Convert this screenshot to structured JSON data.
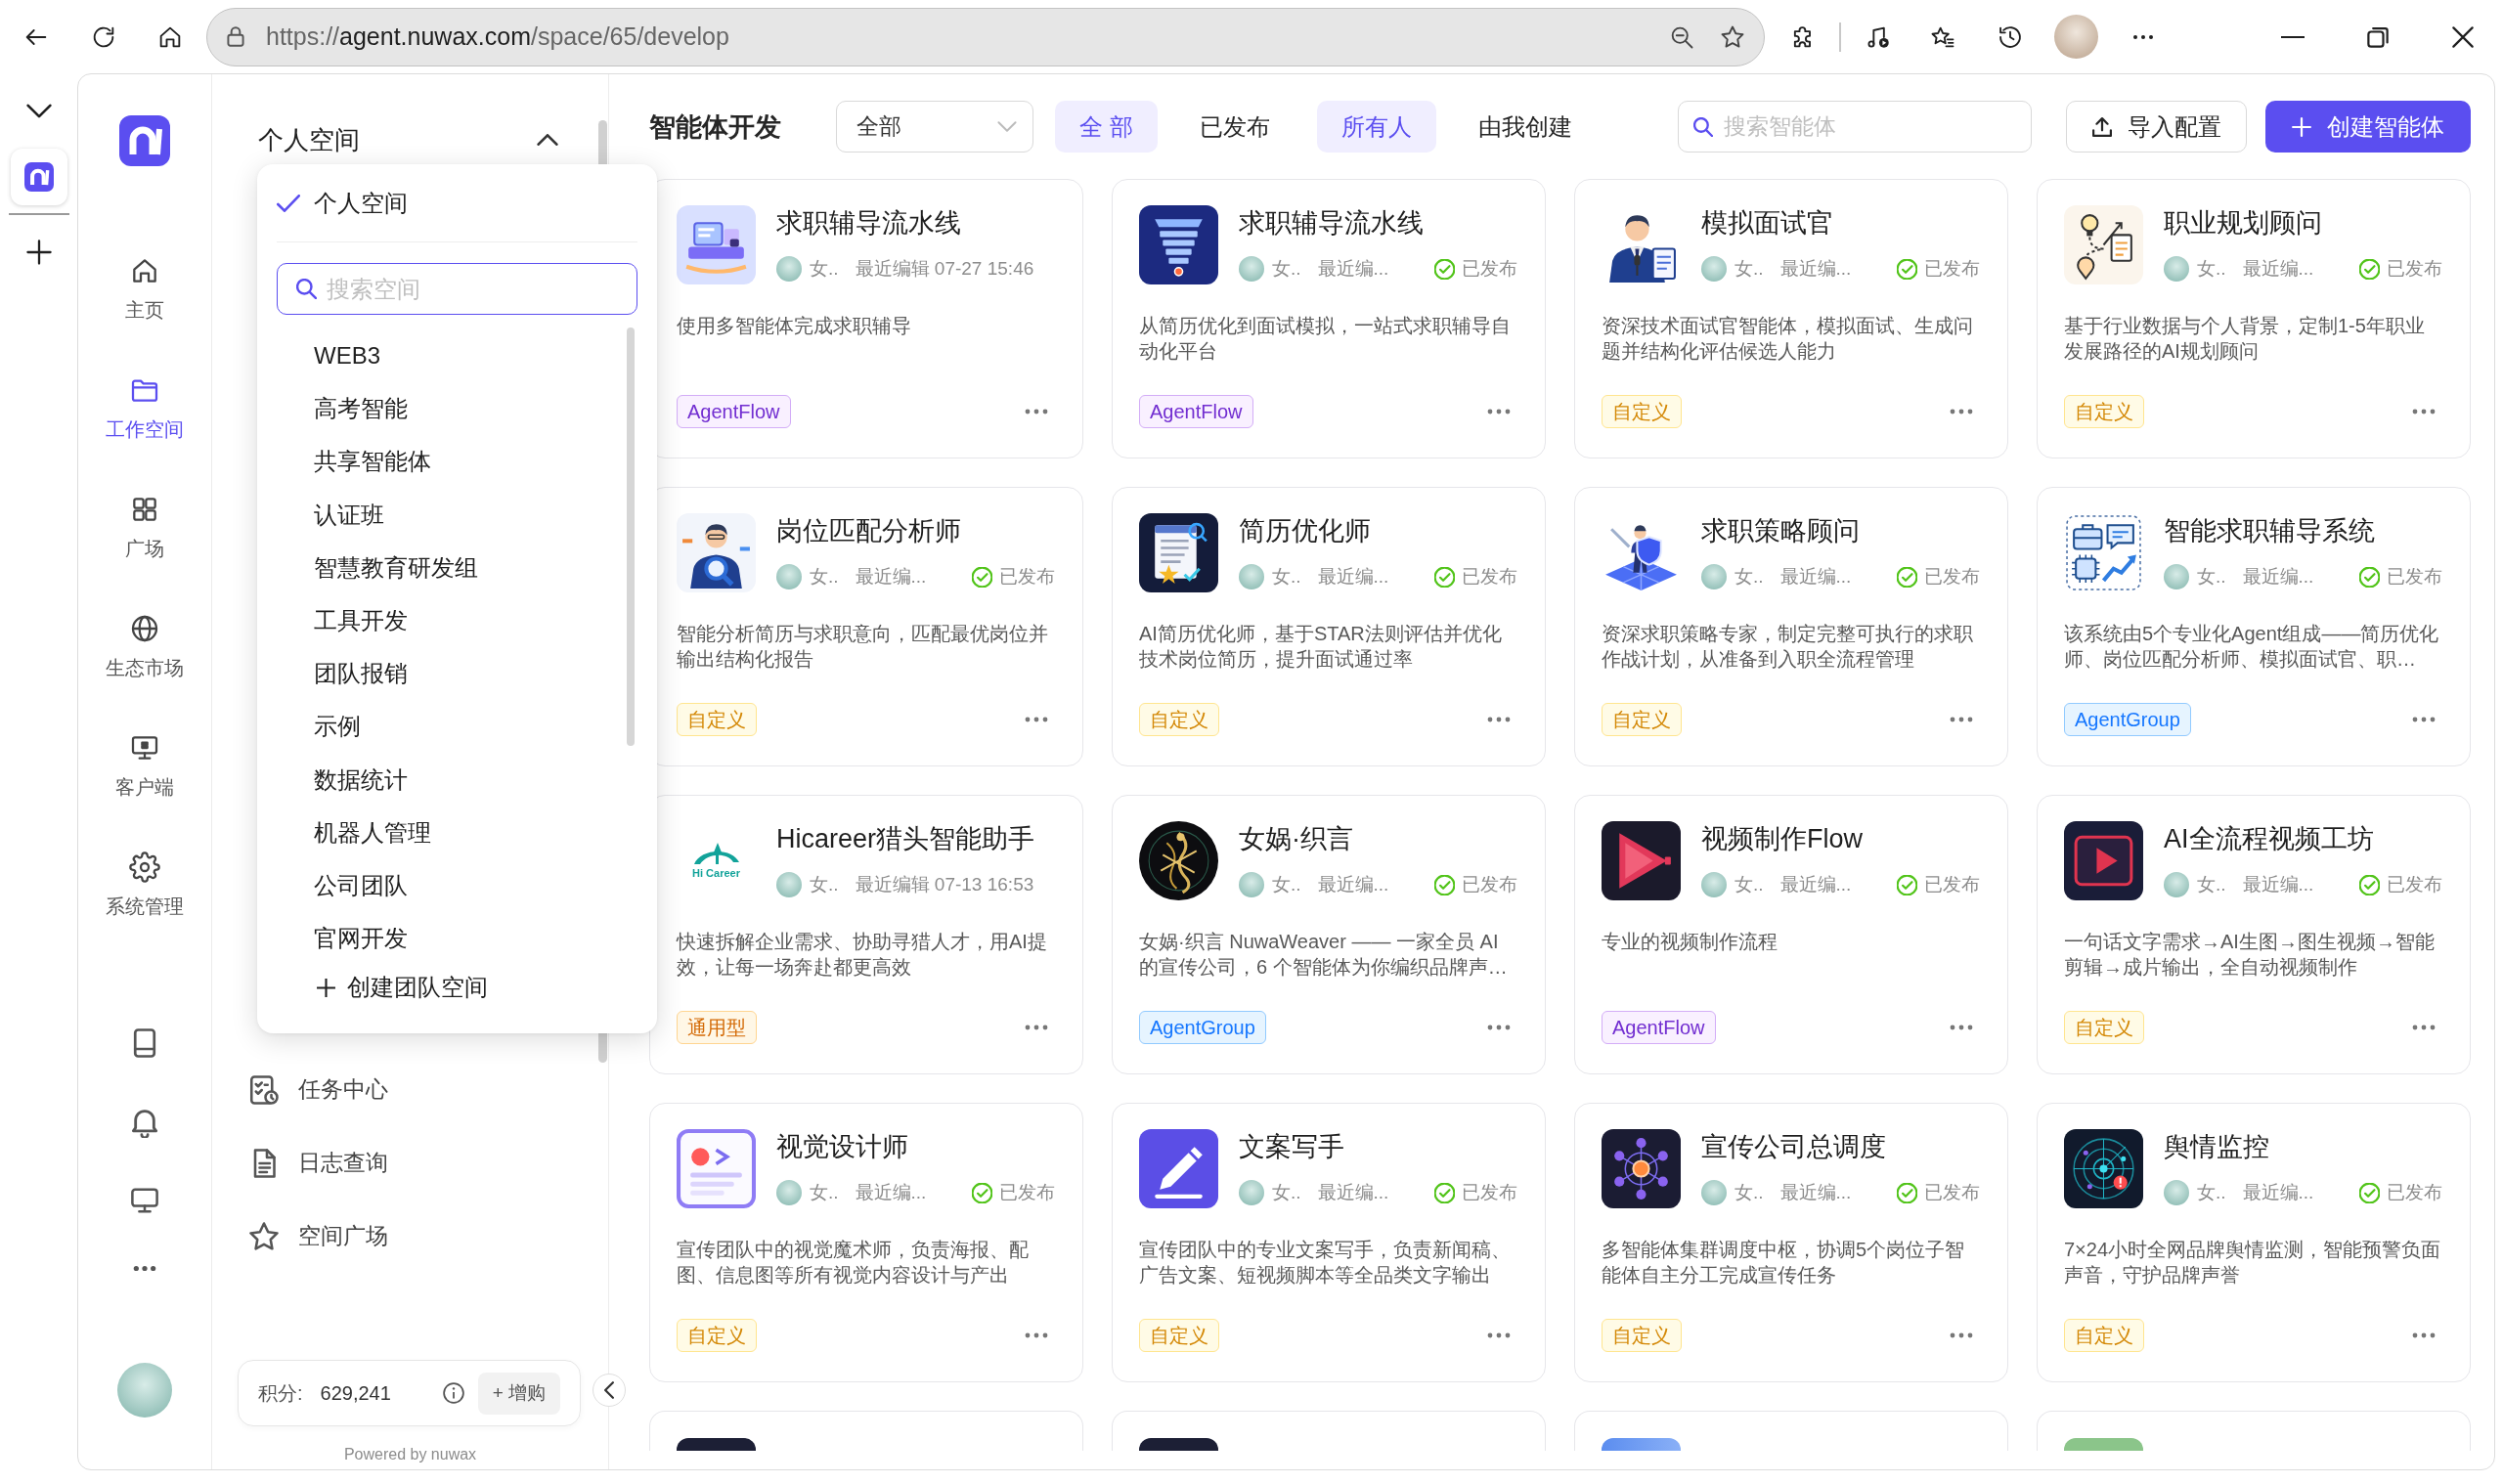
{
  "browser": {
    "url": {
      "scheme": "https://",
      "host": "agent.nuwax.com",
      "path": "/space/65/develop"
    }
  },
  "nav": {
    "items": [
      {
        "label": "主页",
        "kind": "home",
        "selected": false
      },
      {
        "label": "工作空间",
        "kind": "folder",
        "selected": true
      },
      {
        "label": "广场",
        "kind": "grid",
        "selected": false
      },
      {
        "label": "生态市场",
        "kind": "globe",
        "selected": false
      },
      {
        "label": "客户端",
        "kind": "client",
        "selected": false
      },
      {
        "label": "系统管理",
        "kind": "gear",
        "selected": false
      }
    ]
  },
  "sidebar": {
    "title": "个人空间",
    "expanded": true,
    "items": [
      {
        "label": "任务中心",
        "kind": "tasks"
      },
      {
        "label": "日志查询",
        "kind": "log"
      },
      {
        "label": "空间广场",
        "kind": "star"
      }
    ],
    "credits": {
      "label": "积分:",
      "value": "629,241",
      "button": "+ 增购"
    },
    "footer": "Powered by nuwax"
  },
  "space_dropdown": {
    "current": {
      "label": "个人空间",
      "selected": true
    },
    "search": {
      "placeholder": "搜索空间"
    },
    "items": [
      {
        "label": "WEB3",
        "selected": false
      },
      {
        "label": "高考智能",
        "selected": false
      },
      {
        "label": "共享智能体",
        "selected": false
      },
      {
        "label": "认证班",
        "selected": false
      },
      {
        "label": "智慧教育研发组",
        "selected": false
      },
      {
        "label": "工具开发",
        "selected": false
      },
      {
        "label": "团队报销",
        "selected": false
      },
      {
        "label": "示例",
        "selected": false
      },
      {
        "label": "数据统计",
        "selected": false
      },
      {
        "label": "机器人管理",
        "selected": false
      },
      {
        "label": "公司团队",
        "selected": false
      },
      {
        "label": "官网开发",
        "selected": false
      }
    ],
    "create": "创建团队空间"
  },
  "header": {
    "title": "智能体开发",
    "filter": {
      "value": "全部"
    },
    "status_tabs": [
      {
        "label": "全 部",
        "selected": true
      },
      {
        "label": "已发布",
        "selected": false
      }
    ],
    "owner_tabs": [
      {
        "label": "所有人",
        "selected": true
      },
      {
        "label": "由我创建",
        "selected": false
      }
    ],
    "search": {
      "placeholder": "搜索智能体"
    },
    "buttons": [
      {
        "label": "导入配置",
        "kind": "import"
      },
      {
        "label": "创建智能体",
        "kind": "create"
      }
    ]
  },
  "cards": [
    {
      "title": "求职辅导流水线",
      "kind": "workbench",
      "author": "女..",
      "edited": "最近编辑 07-27 15:46",
      "description": "使用多智能体完成求职辅导",
      "tag": {
        "label": "AgentFlow",
        "kind": "flow"
      }
    },
    {
      "title": "求职辅导流水线",
      "kind": "funnel",
      "author": "女..",
      "edited": "最近编...",
      "status": "已发布",
      "description": "从简历优化到面试模拟，一站式求职辅导自动化平台",
      "tag": {
        "label": "AgentFlow",
        "kind": "flow"
      }
    },
    {
      "title": "模拟面试官",
      "kind": "interviewer",
      "author": "女..",
      "edited": "最近编...",
      "status": "已发布",
      "description": "资深技术面试官智能体，模拟面试、生成问题并结构化评估候选人能力",
      "tag": {
        "label": "自定义",
        "kind": "custom"
      }
    },
    {
      "title": "职业规划顾问",
      "kind": "roadmap",
      "author": "女..",
      "edited": "最近编...",
      "status": "已发布",
      "description": "基于行业数据与个人背景，定制1-5年职业发展路径的AI规划顾问",
      "tag": {
        "label": "自定义",
        "kind": "custom"
      }
    },
    {
      "title": "岗位匹配分析师",
      "kind": "analyst",
      "author": "女..",
      "edited": "最近编...",
      "status": "已发布",
      "description": "智能分析简历与求职意向，匹配最优岗位并输出结构化报告",
      "tag": {
        "label": "自定义",
        "kind": "custom"
      }
    },
    {
      "title": "简历优化师",
      "kind": "resume",
      "author": "女..",
      "edited": "最近编...",
      "status": "已发布",
      "description": "AI简历优化师，基于STAR法则评估并优化技术岗位简历，提升面试通过率",
      "tag": {
        "label": "自定义",
        "kind": "custom"
      }
    },
    {
      "title": "求职策略顾问",
      "kind": "strategist",
      "author": "女..",
      "edited": "最近编...",
      "status": "已发布",
      "description": "资深求职策略专家，制定完整可执行的求职作战计划，从准备到入职全流程管理",
      "tag": {
        "label": "自定义",
        "kind": "custom"
      }
    },
    {
      "title": "智能求职辅导系统",
      "kind": "system",
      "author": "女..",
      "edited": "最近编...",
      "status": "已发布",
      "description": "该系统由5个专业化Agent组成——简历优化师、岗位匹配分析师、模拟面试官、职…",
      "tag": {
        "label": "AgentGroup",
        "kind": "group"
      }
    },
    {
      "title": "Hicareer猎头智能助手",
      "kind": "hicareer",
      "logo_text": "Hi Career",
      "author": "女..",
      "edited": "最近编辑 07-13 16:53",
      "description": "快速拆解企业需求、协助寻猎人才，用AI提效，让每一场奔赴都更高效",
      "tag": {
        "label": "通用型",
        "kind": "general"
      }
    },
    {
      "title": "女娲·织言",
      "kind": "nuwa",
      "author": "女..",
      "edited": "最近编...",
      "status": "已发布",
      "description": "女娲·织言 NuwaWeaver —— 一家全员 AI 的宣传公司，6 个智能体为你编织品牌声…",
      "tag": {
        "label": "AgentGroup",
        "kind": "group"
      }
    },
    {
      "title": "视频制作Flow",
      "kind": "video-flow",
      "author": "女..",
      "edited": "最近编...",
      "status": "已发布",
      "description": "专业的视频制作流程",
      "tag": {
        "label": "AgentFlow",
        "kind": "flow"
      }
    },
    {
      "title": "AI全流程视频工坊",
      "kind": "video-studio",
      "author": "女..",
      "edited": "最近编...",
      "status": "已发布",
      "description": "一句话文字需求→AI生图→图生视频→智能剪辑→成片输出，全自动视频制作",
      "tag": {
        "label": "自定义",
        "kind": "custom"
      }
    },
    {
      "title": "视觉设计师",
      "kind": "visual",
      "author": "女..",
      "edited": "最近编...",
      "status": "已发布",
      "description": "宣传团队中的视觉魔术师，负责海报、配图、信息图等所有视觉内容设计与产出",
      "tag": {
        "label": "自定义",
        "kind": "custom"
      }
    },
    {
      "title": "文案写手",
      "kind": "writer",
      "author": "女..",
      "edited": "最近编...",
      "status": "已发布",
      "description": "宣传团队中的专业文案写手，负责新闻稿、广告文案、短视频脚本等全品类文字输出",
      "tag": {
        "label": "自定义",
        "kind": "custom"
      }
    },
    {
      "title": "宣传公司总调度",
      "kind": "hub",
      "author": "女..",
      "edited": "最近编...",
      "status": "已发布",
      "description": "多智能体集群调度中枢，协调5个岗位子智能体自主分工完成宣传任务",
      "tag": {
        "label": "自定义",
        "kind": "custom"
      }
    },
    {
      "title": "舆情监控",
      "kind": "radar",
      "author": "女..",
      "edited": "最近编...",
      "status": "已发布",
      "description": "7×24小时全网品牌舆情监测，智能预警负面声音，守护品牌声誉",
      "tag": {
        "label": "自定义",
        "kind": "custom"
      }
    }
  ],
  "more_cards": [
    {
      "kind": "dark"
    },
    {
      "kind": "dark"
    },
    {
      "kind": "blue"
    },
    {
      "kind": "green"
    }
  ]
}
